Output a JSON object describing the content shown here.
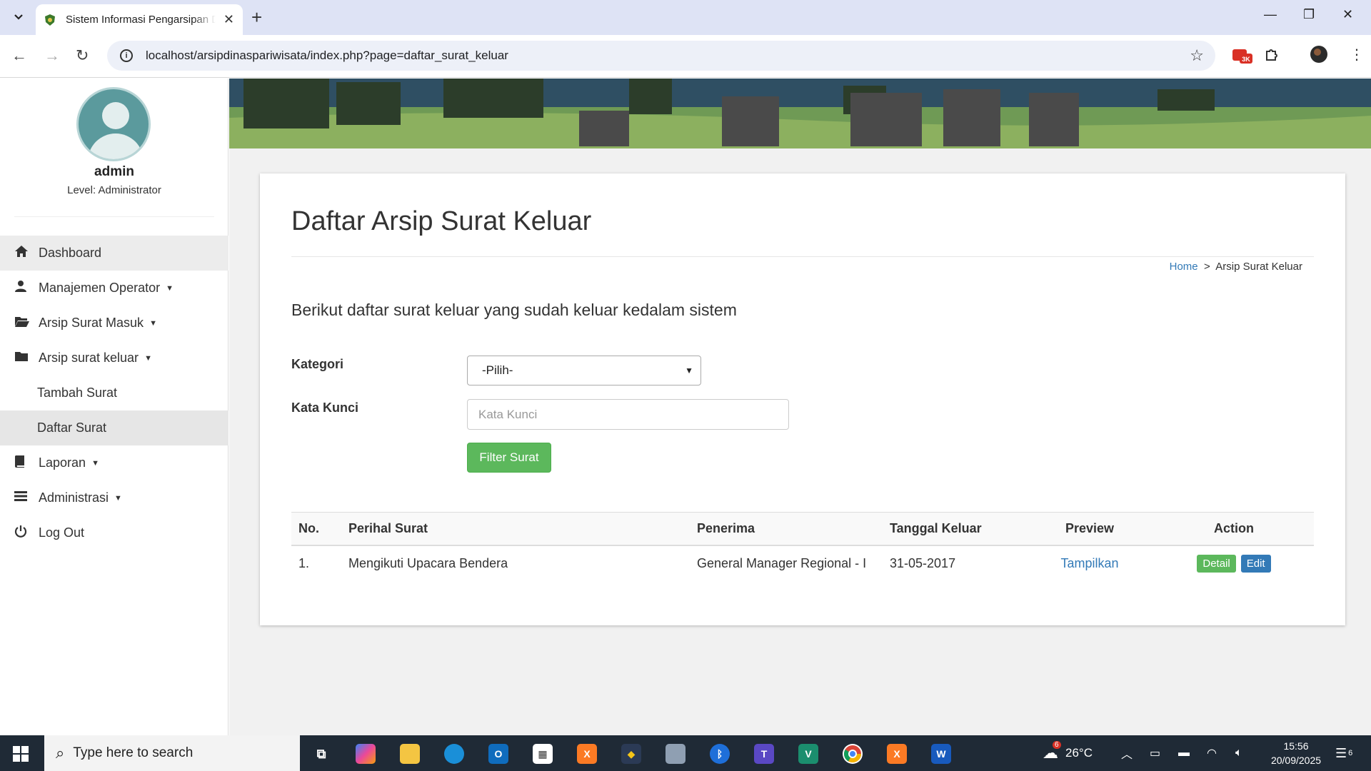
{
  "browser": {
    "tab_title": "Sistem Informasi Pengarsipan Dinas Pariwisata",
    "url": "localhost/arsipdinaspariwisata/index.php?page=daftar_surat_keluar",
    "ext_badge": "3K"
  },
  "user": {
    "name": "admin",
    "level": "Level: Administrator"
  },
  "menu": {
    "dashboard": "Dashboard",
    "operator": "Manajemen Operator",
    "surat_masuk": "Arsip Surat Masuk",
    "surat_keluar": "Arsip surat keluar",
    "tambah": "Tambah Surat",
    "daftar": "Daftar Surat",
    "laporan": "Laporan",
    "administrasi": "Administrasi",
    "logout": "Log Out"
  },
  "page": {
    "title": "Daftar Arsip Surat Keluar",
    "breadcrumb_home": "Home",
    "breadcrumb_sep": ">",
    "breadcrumb_current": "Arsip Surat Keluar",
    "lead": "Berikut daftar surat keluar yang sudah keluar kedalam sistem"
  },
  "filter": {
    "kategori_label": "Kategori",
    "kategori_value": "-Pilih-",
    "kunci_label": "Kata Kunci",
    "kunci_placeholder": "Kata Kunci",
    "button": "Filter Surat"
  },
  "table": {
    "headers": [
      "No.",
      "Perihal Surat",
      "Penerima",
      "Tanggal Keluar",
      "Preview",
      "Action"
    ],
    "rows": [
      {
        "no": "1.",
        "perihal": "Mengikuti Upacara Bendera",
        "penerima": "General Manager Regional - I",
        "tanggal": "31-05-2017",
        "preview": "Tampilkan",
        "detail": "Detail",
        "edit": "Edit"
      }
    ]
  },
  "taskbar": {
    "search_placeholder": "Type here to search",
    "weather": "26°C",
    "weather_badge": "6",
    "time": "15:56",
    "date": "20/09/2025",
    "notif_count": "6"
  }
}
